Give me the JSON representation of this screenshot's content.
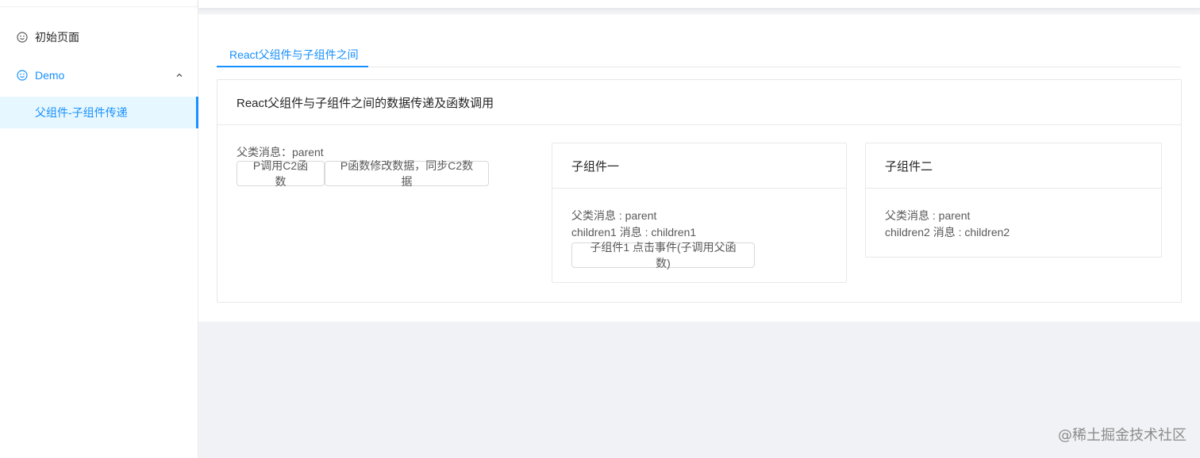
{
  "sidebar": {
    "items": [
      {
        "label": "初始页面",
        "icon": "smile-icon"
      },
      {
        "label": "Demo",
        "icon": "smile-icon",
        "expanded": true,
        "children": [
          {
            "label": "父组件-子组件传递",
            "selected": true
          }
        ]
      }
    ]
  },
  "tabs": [
    {
      "label": "React父组件与子组件之间",
      "active": true
    }
  ],
  "main_card": {
    "title": "React父组件与子组件之间的数据传递及函数调用",
    "parent": {
      "message": "父类消息：parent",
      "buttons": [
        "P调用C2函数",
        "P函数修改数据，同步C2数据"
      ]
    },
    "child1": {
      "title": "子组件一",
      "parent_message": "父类消息 : parent",
      "child_message": "children1 消息 : children1",
      "button": "子组件1 点击事件(子调用父函数)"
    },
    "child2": {
      "title": "子组件二",
      "parent_message": "父类消息 : parent",
      "child_message": "children2 消息 : children2"
    }
  },
  "watermark": "@稀土掘金技术社区",
  "colors": {
    "primary": "#1890ff",
    "selected_bg": "#e6f7ff",
    "page_bg": "#f0f2f5"
  }
}
